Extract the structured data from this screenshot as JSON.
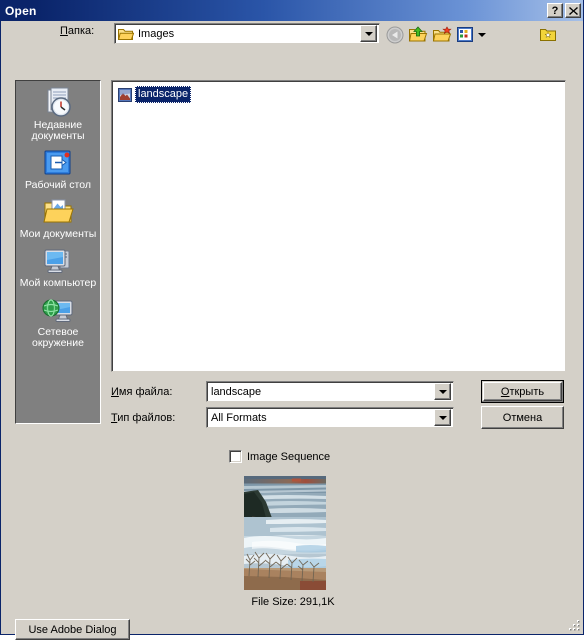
{
  "window": {
    "title": "Open",
    "help_button": "?",
    "close_button": "✕"
  },
  "toolbar": {
    "lookin_label_accel": "П",
    "lookin_label_rest": "апка:",
    "lookin_value": "Images",
    "icons": [
      {
        "name": "back-icon",
        "title": "Назад"
      },
      {
        "name": "up-one-level-icon",
        "title": "Переход на один уровень вверх"
      },
      {
        "name": "new-folder-icon",
        "title": "Создание новой папки"
      },
      {
        "name": "views-icon",
        "title": "Меню \"Вид\""
      },
      {
        "name": "tools-folder-icon",
        "title": "Сервис"
      }
    ]
  },
  "places": {
    "items": [
      {
        "icon": "recent-documents-icon",
        "label": "Недавние документы"
      },
      {
        "icon": "desktop-icon",
        "label": "Рабочий стол"
      },
      {
        "icon": "my-documents-icon",
        "label": "Мои документы"
      },
      {
        "icon": "my-computer-icon",
        "label": "Мой компьютер"
      },
      {
        "icon": "network-places-icon",
        "label": "Сетевое окружение"
      }
    ]
  },
  "filelist": {
    "items": [
      {
        "name": "landscape",
        "selected": true
      }
    ]
  },
  "fields": {
    "filename_label_accel": "И",
    "filename_label_rest": "мя файла:",
    "filename_value": "landscape",
    "filetype_label_accel": "Т",
    "filetype_label_rest": "ип файлов:",
    "filetype_value": "All Formats"
  },
  "buttons": {
    "open_accel": "О",
    "open_rest": "ткрыть",
    "cancel": "Отмена",
    "use_adobe_dialog": "Use Adobe Dialog"
  },
  "options": {
    "image_sequence_label": "Image Sequence",
    "image_sequence_checked": false
  },
  "preview": {
    "file_size_text": "File Size: 291,1K",
    "description": "winter lakeshore with ice floes, bare trees and a rocky bluff"
  },
  "colors": {
    "dialog_face": "#d4d0c8",
    "title_active_start": "#0a246a",
    "title_active_end": "#a6c0e8",
    "places_bar": "#808080",
    "selection": "#0a246a",
    "list_background": "#ffffff"
  }
}
